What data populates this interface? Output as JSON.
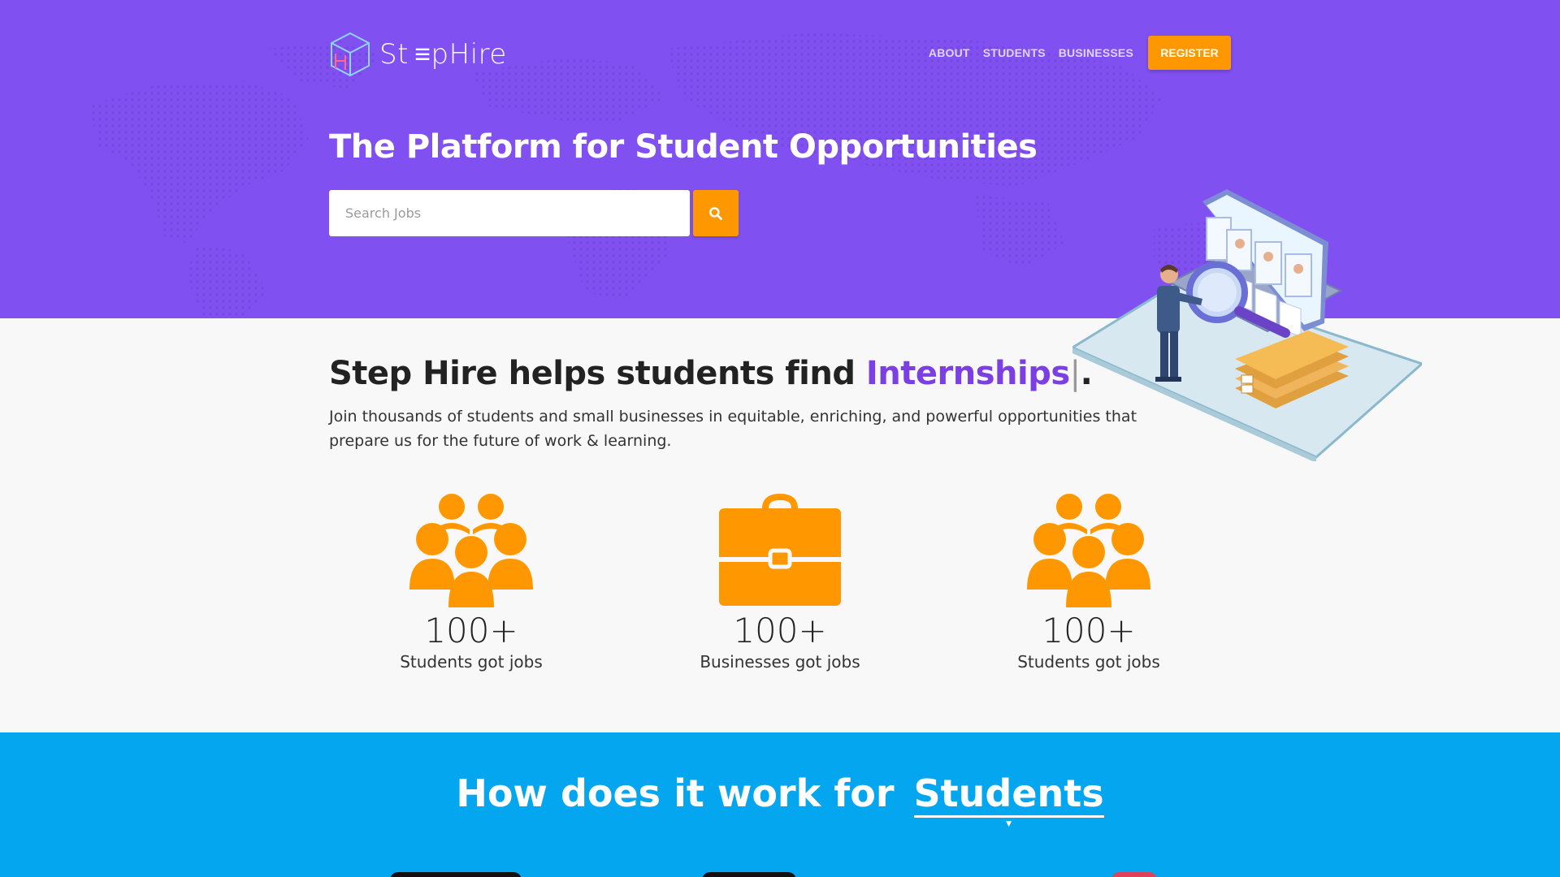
{
  "brand": {
    "name": "StepHire",
    "name_display": "St ≡pHire"
  },
  "nav": {
    "links": [
      "ABOUT",
      "STUDENTS",
      "BUSINESSES"
    ],
    "register_label": "REGISTER"
  },
  "hero": {
    "title": "The Platform for Student Opportunities",
    "search_placeholder": "Search Jobs",
    "search_icon": "search-icon"
  },
  "intro": {
    "title_prefix": "Step Hire helps students find ",
    "title_highlight": "Internships",
    "title_cursor": "|",
    "title_suffix": ".",
    "description": "Join thousands of students and small businesses in equitable, enriching, and powerful opportunities that prepare us for the future of work & learning."
  },
  "stats": [
    {
      "icon": "people-group-icon",
      "value": "100+",
      "label": "Students got jobs"
    },
    {
      "icon": "briefcase-icon",
      "value": "100+",
      "label": "Businesses got jobs"
    },
    {
      "icon": "people-group-icon",
      "value": "100+",
      "label": "Students got jobs"
    }
  ],
  "how": {
    "title_prefix": "How does it work for ",
    "selected": "Students"
  },
  "colors": {
    "hero_bg": "#8150f0",
    "accent_orange": "#ff9800",
    "highlight_purple": "#7b3fe4",
    "how_bg": "#05a6f0"
  }
}
